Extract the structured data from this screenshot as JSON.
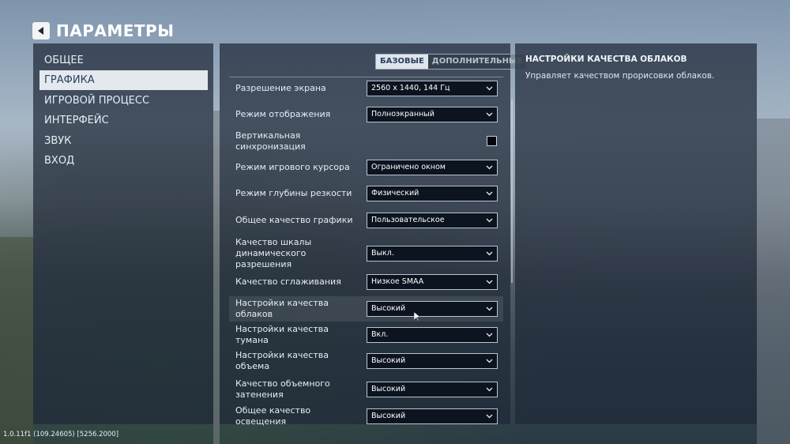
{
  "header": {
    "title": "ПАРАМЕТРЫ",
    "back_icon": "arrow-left-icon"
  },
  "sidebar": {
    "items": [
      {
        "label": "ОБЩЕЕ",
        "active": false
      },
      {
        "label": "ГРАФИКА",
        "active": true
      },
      {
        "label": "ИГРОВОЙ ПРОЦЕСС",
        "active": false
      },
      {
        "label": "ИНТЕРФЕЙС",
        "active": false
      },
      {
        "label": "ЗВУК",
        "active": false
      },
      {
        "label": "ВХОД",
        "active": false
      }
    ]
  },
  "tabs": {
    "basic": "БАЗОВЫЕ",
    "advanced": "ДОПОЛНИТЕЛЬНЫЕ",
    "selected": "basic"
  },
  "settings": [
    {
      "label": "Разрешение экрана",
      "type": "dropdown",
      "value": "2560 x 1440, 144 Гц"
    },
    {
      "label": "Режим отображения",
      "type": "dropdown",
      "value": "Полноэкранный"
    },
    {
      "label": "Вертикальная синхронизация",
      "type": "checkbox",
      "checked": false
    },
    {
      "label": "Режим игрового курсора",
      "type": "dropdown",
      "value": "Ограничено окном"
    },
    {
      "label": "Режим глубины резкости",
      "type": "dropdown",
      "value": "Физический"
    },
    {
      "label": "Общее качество графики",
      "type": "dropdown",
      "value": "Пользовательское"
    },
    {
      "label": "Качество шкалы динамического разрешения",
      "type": "dropdown",
      "value": "Выкл."
    },
    {
      "label": "Качество сглаживания",
      "type": "dropdown",
      "value": "Низкое SMAA"
    },
    {
      "label": "Настройки качества облаков",
      "type": "dropdown",
      "value": "Высокий",
      "hovered": true
    },
    {
      "label": "Настройки качества тумана",
      "type": "dropdown",
      "value": "Вкл."
    },
    {
      "label": "Настройки качества объема",
      "type": "dropdown",
      "value": "Высокий"
    },
    {
      "label": "Качество объемного затенения",
      "type": "dropdown",
      "value": "Высокий"
    },
    {
      "label": "Общее качество освещения",
      "type": "dropdown",
      "value": "Высокий"
    }
  ],
  "info": {
    "title": "НАСТРОЙКИ КАЧЕСТВА ОБЛАКОВ",
    "description": "Управляет качеством прорисовки облаков."
  },
  "version": "1.0.11f1 (109.24605) [5256.2000]",
  "colors": {
    "panel": "#1e2837",
    "active_bg": "#e4e9ee",
    "active_text": "#2a4060",
    "dropdown_bg": "#0c1420"
  }
}
